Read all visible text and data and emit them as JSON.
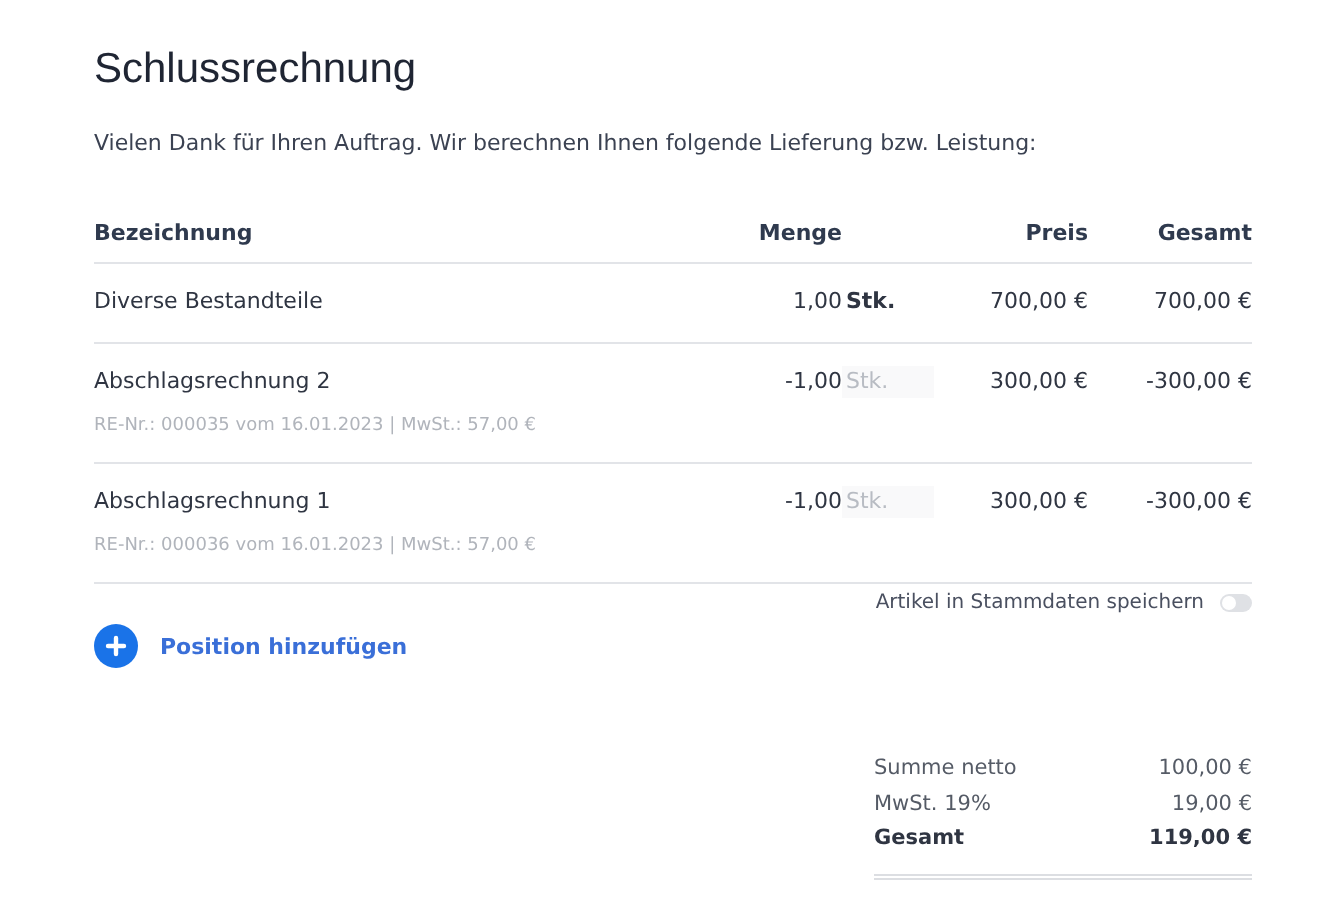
{
  "title": "Schlussrechnung",
  "intro": "Vielen Dank für Ihren Auftrag. Wir berechnen Ihnen folgende Lieferung bzw. Leistung:",
  "table": {
    "columns": [
      "Bezeichnung",
      "Menge",
      "Preis",
      "Gesamt"
    ],
    "rows": [
      {
        "name": "Diverse Bestandteile",
        "quantity": "1,00",
        "unit": "Stk.",
        "unit_disabled": false,
        "price": "700,00 €",
        "total": "700,00 €"
      },
      {
        "name": "Abschlagsrechnung 2",
        "detail": "RE-Nr.: 000035 vom 16.01.2023 | MwSt.: 57,00 €",
        "quantity": "-1,00",
        "unit": "Stk.",
        "unit_disabled": true,
        "price": "300,00 €",
        "total": "-300,00 €"
      },
      {
        "name": "Abschlagsrechnung 1",
        "detail": "RE-Nr.: 000036 vom 16.01.2023 | MwSt.: 57,00 €",
        "quantity": "-1,00",
        "unit": "Stk.",
        "unit_disabled": true,
        "price": "300,00 €",
        "total": "-300,00 €"
      }
    ]
  },
  "save_toggle": {
    "label": "Artikel in Stammdaten speichern",
    "on": false
  },
  "add_button": {
    "label": "Position hinzufügen"
  },
  "totals": [
    {
      "label": "Summe netto",
      "value": "100,00 €",
      "kind": "normal"
    },
    {
      "label": "MwSt. 19%",
      "value": "19,00 €",
      "kind": "normal"
    },
    {
      "label": "Gesamt",
      "value": "119,00 €",
      "kind": "grand"
    }
  ]
}
